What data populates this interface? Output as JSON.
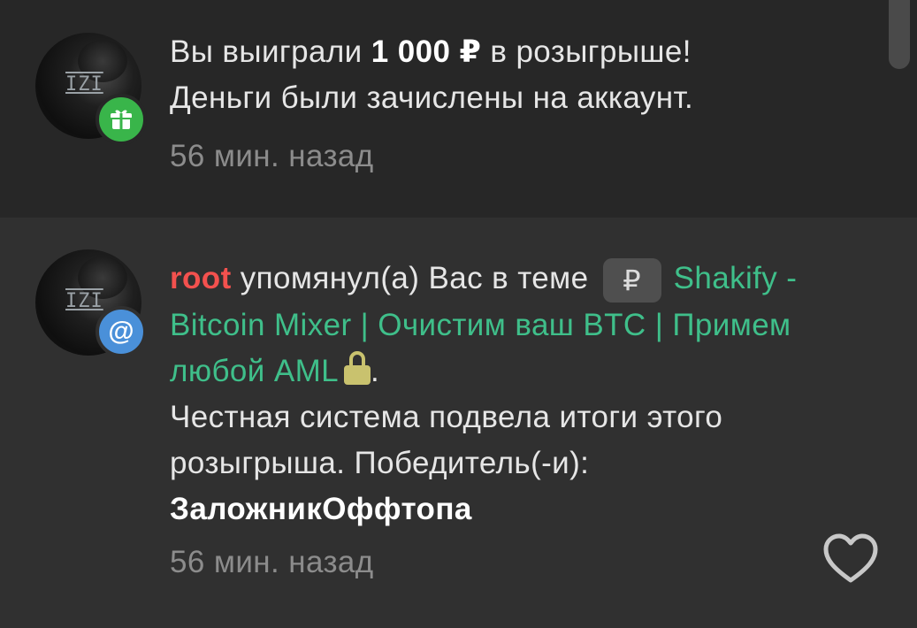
{
  "notifications": [
    {
      "badge_icon": "gift-icon",
      "badge_color": "#39b54a",
      "message": {
        "prefix": "Вы выиграли ",
        "amount": "1 000 ₽",
        "suffix": " в розыгрыше!",
        "line2": "Деньги были зачислены на аккаунт."
      },
      "time": "56 мин. назад"
    },
    {
      "badge_icon": "at-icon",
      "badge_symbol": "@",
      "badge_color": "#4a90d9",
      "username": "root",
      "action": " упомянул(а) Вас в теме ",
      "thread_prefix": "₽",
      "thread_title": "Shakify - Bitcoin Mixer | Очистим ваш BTC | Примем любой AML",
      "period": ".",
      "body_text": "Честная система подвела итоги этого розыгрыша. Победитель(-и):",
      "winner": "ЗаложникОффтопа",
      "time": "56 мин. назад"
    }
  ],
  "colors": {
    "username": "#f3514e",
    "thread_link": "#3fbf8a",
    "lock": "#c9c26e",
    "time": "#8c8c8c"
  }
}
